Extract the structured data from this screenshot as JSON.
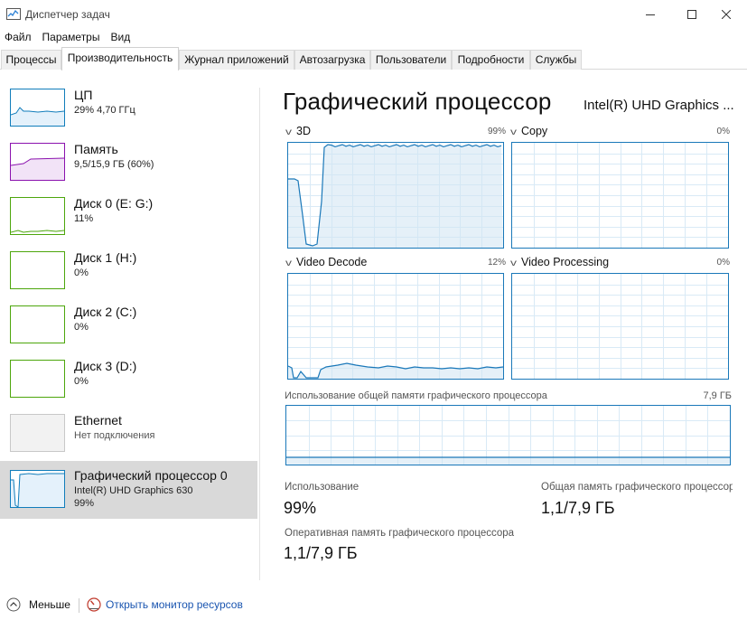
{
  "window": {
    "title": "Диспетчер задач",
    "icons": {
      "app": "task-manager-icon",
      "minimize": "minimize-icon",
      "maximize": "maximize-icon",
      "close": "close-icon"
    }
  },
  "menu": [
    "Файл",
    "Параметры",
    "Вид"
  ],
  "tabs": [
    {
      "label": "Процессы",
      "active": false
    },
    {
      "label": "Производительность",
      "active": true
    },
    {
      "label": "Журнал приложений",
      "active": false
    },
    {
      "label": "Автозагрузка",
      "active": false
    },
    {
      "label": "Пользователи",
      "active": false
    },
    {
      "label": "Подробности",
      "active": false
    },
    {
      "label": "Службы",
      "active": false
    }
  ],
  "resources": [
    {
      "name": "ЦП",
      "line1": "29% 4,70 ГГц",
      "line2": "",
      "color": "#117dbb",
      "selected": false
    },
    {
      "name": "Память",
      "line1": "9,5/15,9 ГБ (60%)",
      "line2": "",
      "color": "#8b12ae",
      "selected": false
    },
    {
      "name": "Диск 0 (E: G:)",
      "line1": "11%",
      "line2": "",
      "color": "#4da60c",
      "selected": false
    },
    {
      "name": "Диск 1 (H:)",
      "line1": "0%",
      "line2": "",
      "color": "#4da60c",
      "selected": false
    },
    {
      "name": "Диск 2 (C:)",
      "line1": "0%",
      "line2": "",
      "color": "#4da60c",
      "selected": false
    },
    {
      "name": "Диск 3 (D:)",
      "line1": "0%",
      "line2": "",
      "color": "#4da60c",
      "selected": false
    },
    {
      "name": "Ethernet",
      "line1": "Нет подключения",
      "line2": "",
      "color": "#bbbbbb",
      "selected": false
    },
    {
      "name": "Графический процессор 0",
      "line1": "Intel(R) UHD Graphics 630",
      "line2": "99%",
      "color": "#117dbb",
      "selected": true
    }
  ],
  "gpu": {
    "title": "Графический процессор",
    "model": "Intel(R) UHD Graphics ...",
    "graphs": [
      {
        "name": "3D",
        "percent": "99%"
      },
      {
        "name": "Copy",
        "percent": "0%"
      },
      {
        "name": "Video Decode",
        "percent": "12%"
      },
      {
        "name": "Video Processing",
        "percent": "0%"
      }
    ],
    "shared_memory_label": "Использование общей памяти графического процессора",
    "shared_memory_max": "7,9 ГБ",
    "stats": {
      "usage_label": "Использование",
      "usage_value": "99%",
      "shared_label": "Общая память графического процессора",
      "shared_value": "1,1/7,9 ГБ",
      "dedicated_label": "Оперативная память графического процессора",
      "dedicated_value": "1,1/7,9 ГБ"
    },
    "graph_color": "#1a78b9"
  },
  "footer": {
    "fewer_label": "Меньше",
    "monitor_link": "Открыть монитор ресурсов"
  }
}
